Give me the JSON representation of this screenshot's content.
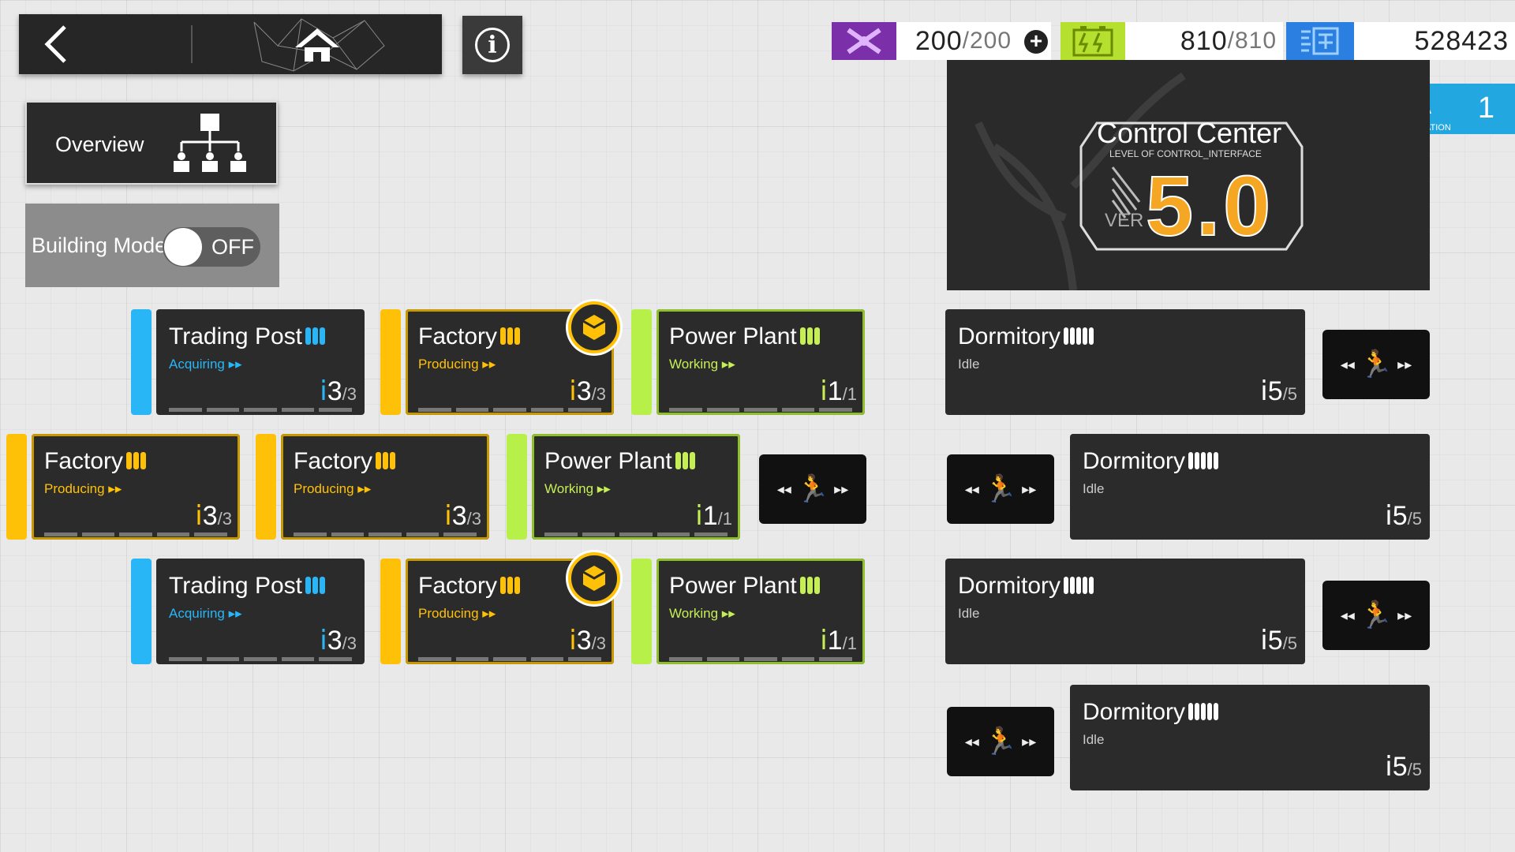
{
  "nav": {
    "back_icon": "chevron-left-icon",
    "home_icon": "home-icon",
    "info_icon": "info-icon",
    "info_glyph": "i"
  },
  "overview": {
    "label": "Overview",
    "icon": "hierarchy-icon"
  },
  "building_mode": {
    "label": "Building Mode",
    "state": "OFF"
  },
  "resources": {
    "drones": {
      "icon": "drone-icon",
      "current": "200",
      "max": "/200",
      "color": "#7b2fa8"
    },
    "power": {
      "icon": "battery-icon",
      "current": "810",
      "max": "/810",
      "color": "#b6e02f"
    },
    "currency": {
      "icon": "currency-icon",
      "value": "528423",
      "color": "#2b7fe0"
    }
  },
  "notification": {
    "count": "1",
    "label": "NOTIFICATION"
  },
  "control_center": {
    "title": "Control Center",
    "subtitle": "LEVEL OF CONTROL_INTERFACE",
    "ver_label": "VER",
    "version": "5.0"
  },
  "rooms": [
    {
      "type": "trade",
      "name": "Trading Post",
      "status": "Acquiring ▸▸",
      "count": "3",
      "max": "/3"
    },
    {
      "type": "fac",
      "name": "Factory",
      "status": "Producing ▸▸",
      "count": "3",
      "max": "/3"
    },
    {
      "type": "pow",
      "name": "Power Plant",
      "status": "Working ▸▸",
      "count": "1",
      "max": "/1"
    },
    {
      "type": "dorm",
      "name": "Dormitory",
      "status": "Idle",
      "count": "5",
      "max": "/5"
    },
    {
      "type": "fac",
      "name": "Factory",
      "status": "Producing ▸▸",
      "count": "3",
      "max": "/3"
    },
    {
      "type": "fac",
      "name": "Factory",
      "status": "Producing ▸▸",
      "count": "3",
      "max": "/3"
    },
    {
      "type": "pow",
      "name": "Power Plant",
      "status": "Working ▸▸",
      "count": "1",
      "max": "/1"
    },
    {
      "type": "dorm",
      "name": "Dormitory",
      "status": "Idle",
      "count": "5",
      "max": "/5"
    },
    {
      "type": "trade",
      "name": "Trading Post",
      "status": "Acquiring ▸▸",
      "count": "3",
      "max": "/3"
    },
    {
      "type": "fac",
      "name": "Factory",
      "status": "Producing ▸▸",
      "count": "3",
      "max": "/3"
    },
    {
      "type": "pow",
      "name": "Power Plant",
      "status": "Working ▸▸",
      "count": "1",
      "max": "/1"
    },
    {
      "type": "dorm",
      "name": "Dormitory",
      "status": "Idle",
      "count": "5",
      "max": "/5"
    },
    {
      "type": "dorm",
      "name": "Dormitory",
      "status": "Idle",
      "count": "5",
      "max": "/5"
    }
  ]
}
